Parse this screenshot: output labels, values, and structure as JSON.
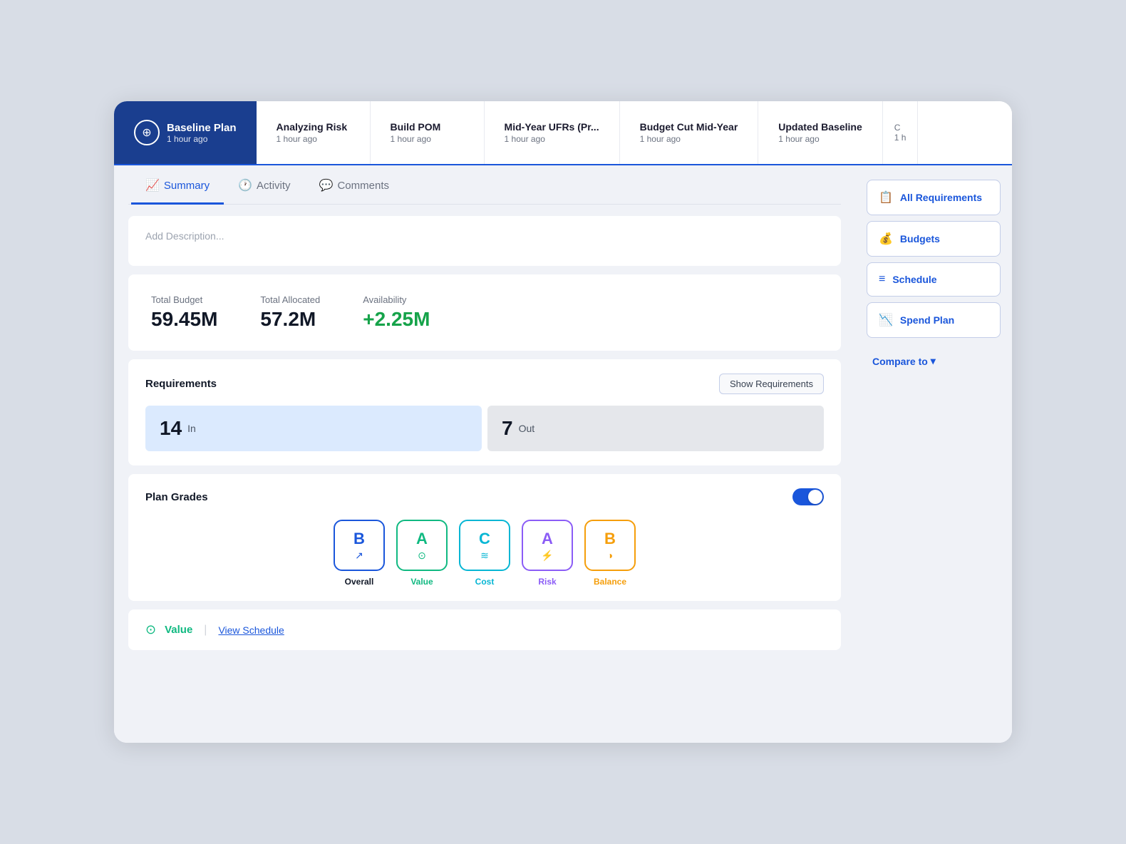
{
  "app": {
    "title": "Baseline Plan"
  },
  "baseline": {
    "label": "Baseline Plan",
    "time": "1 hour ago"
  },
  "navItems": [
    {
      "id": "analyzing-risk",
      "title": "Analyzing Risk",
      "time": "1 hour ago"
    },
    {
      "id": "build-pom",
      "title": "Build POM",
      "time": "1 hour ago"
    },
    {
      "id": "mid-year-ufrs",
      "title": "Mid-Year UFRs (Pr...",
      "time": "1 hour ago"
    },
    {
      "id": "budget-cut-mid-year",
      "title": "Budget Cut Mid-Year",
      "time": "1 hour ago"
    },
    {
      "id": "updated-baseline",
      "title": "Updated Baseline",
      "time": "1 hour ago"
    }
  ],
  "tabs": [
    {
      "id": "summary",
      "label": "Summary",
      "active": true
    },
    {
      "id": "activity",
      "label": "Activity",
      "active": false
    },
    {
      "id": "comments",
      "label": "Comments",
      "active": false
    }
  ],
  "description": {
    "placeholder": "Add Description..."
  },
  "budget": {
    "totalBudgetLabel": "Total Budget",
    "totalBudgetValue": "59.45M",
    "totalAllocatedLabel": "Total Allocated",
    "totalAllocatedValue": "57.2M",
    "availabilityLabel": "Availability",
    "availabilityValue": "+2.25M"
  },
  "requirements": {
    "title": "Requirements",
    "showBtn": "Show Requirements",
    "inCount": "14",
    "inLabel": "In",
    "outCount": "7",
    "outLabel": "Out"
  },
  "planGrades": {
    "title": "Plan Grades",
    "grades": [
      {
        "id": "overall",
        "letter": "B",
        "label": "Overall",
        "icon": "📈"
      },
      {
        "id": "value",
        "letter": "A",
        "label": "Value",
        "icon": "🟢"
      },
      {
        "id": "cost",
        "letter": "C",
        "label": "Cost",
        "icon": "💧"
      },
      {
        "id": "risk",
        "letter": "A",
        "label": "Risk",
        "icon": "⚡"
      },
      {
        "id": "balance",
        "letter": "B",
        "label": "Balance",
        "icon": "🟠"
      }
    ]
  },
  "valueSection": {
    "label": "Value",
    "viewScheduleLabel": "View Schedule"
  },
  "sidebar": {
    "buttons": [
      {
        "id": "all-requirements",
        "label": "All Requirements",
        "icon": "📋"
      },
      {
        "id": "budgets",
        "label": "Budgets",
        "icon": "💰"
      },
      {
        "id": "schedule",
        "label": "Schedule",
        "icon": "📅"
      },
      {
        "id": "spend-plan",
        "label": "Spend Plan",
        "icon": "📊"
      }
    ],
    "compareLabel": "Compare to",
    "compareIcon": "▾"
  }
}
